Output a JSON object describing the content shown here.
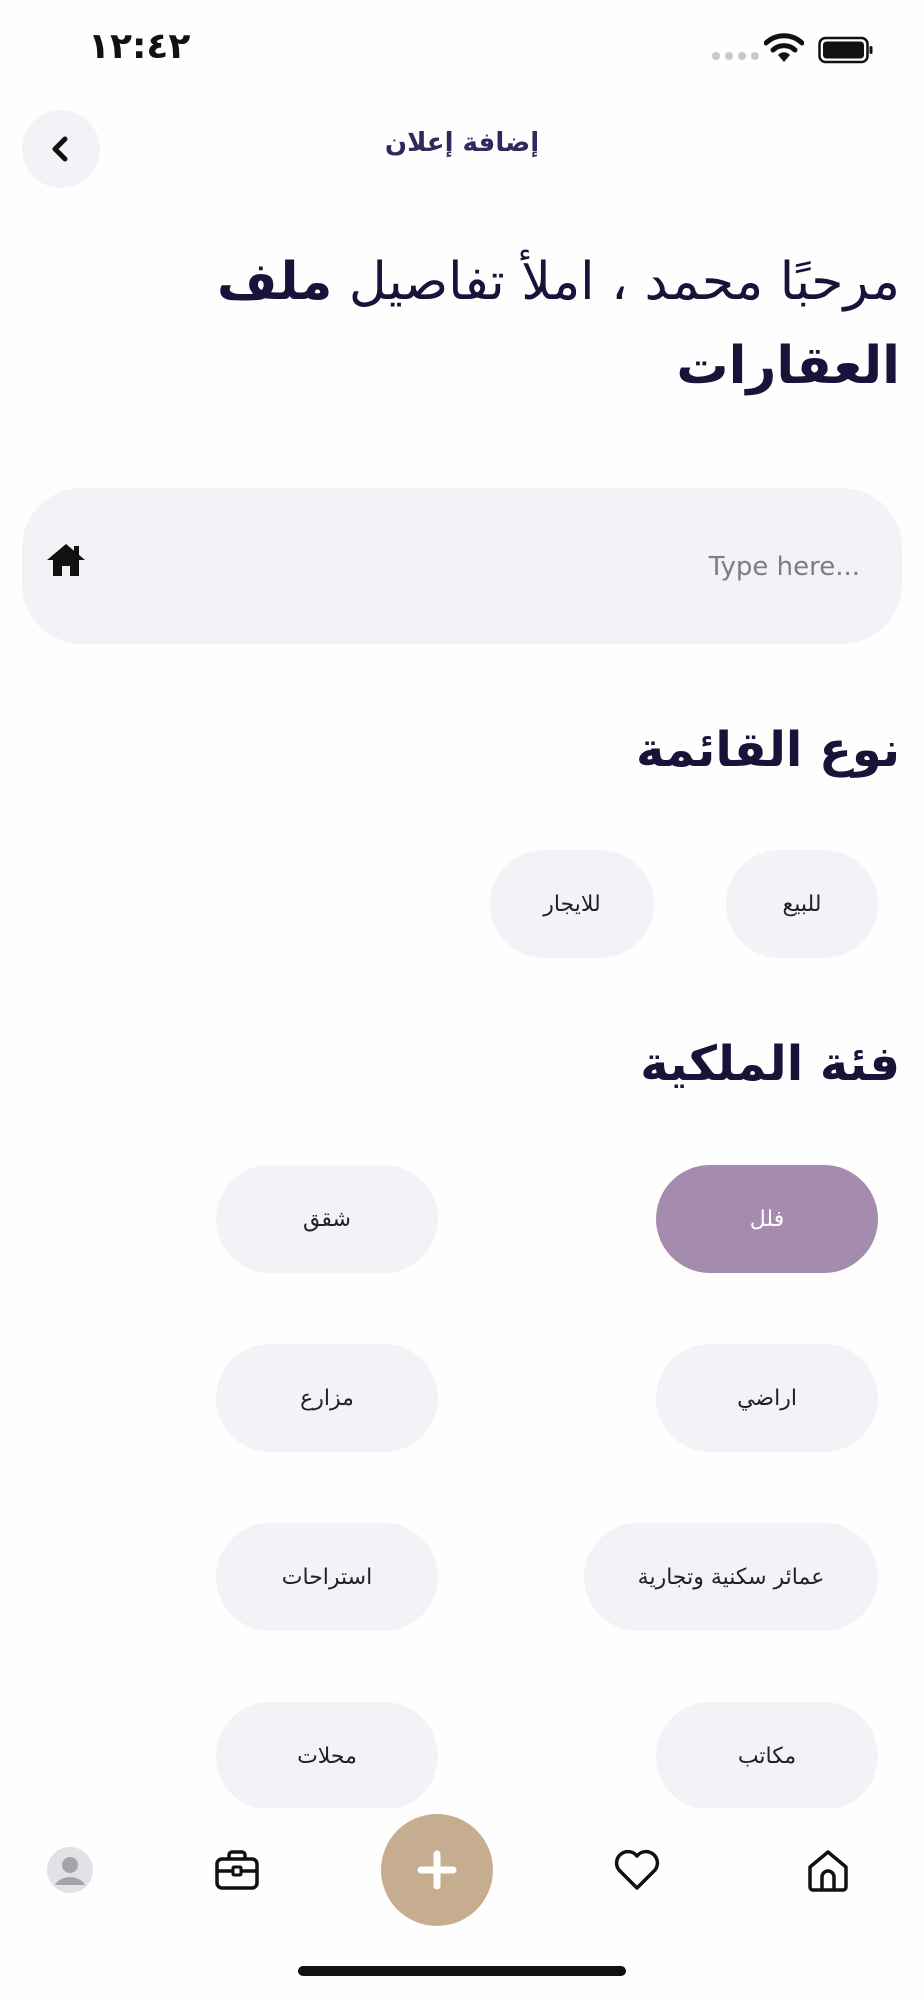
{
  "status_bar": {
    "time": "١٢:٤٢"
  },
  "header": {
    "title": "إضافة إعلان",
    "back_icon": "chevron-left-icon"
  },
  "greeting": {
    "prefix": "مرحبًا محمد ، املأ تفاصيل ",
    "bold": "ملف العقارات"
  },
  "search": {
    "placeholder": "Type here...",
    "value": "",
    "icon": "home-icon"
  },
  "listing_type": {
    "title": "نوع القائمة",
    "options": [
      "للبيع",
      "للايجار"
    ]
  },
  "property_category": {
    "title": "فئة الملكية",
    "options": [
      "فلل",
      "شقق",
      "اراضي",
      "مزارع",
      "عمائر سكنية وتجارية",
      "استراحات",
      "مكاتب",
      "محلات"
    ],
    "selected": "فلل"
  },
  "bottom_nav": {
    "items": [
      "home-icon",
      "heart-icon",
      "plus-icon",
      "briefcase-icon",
      "avatar"
    ]
  },
  "colors": {
    "accent": "#a58bad",
    "fab": "#c7ad90",
    "chip_bg": "#f3f2f7",
    "text": "#1a1238"
  }
}
